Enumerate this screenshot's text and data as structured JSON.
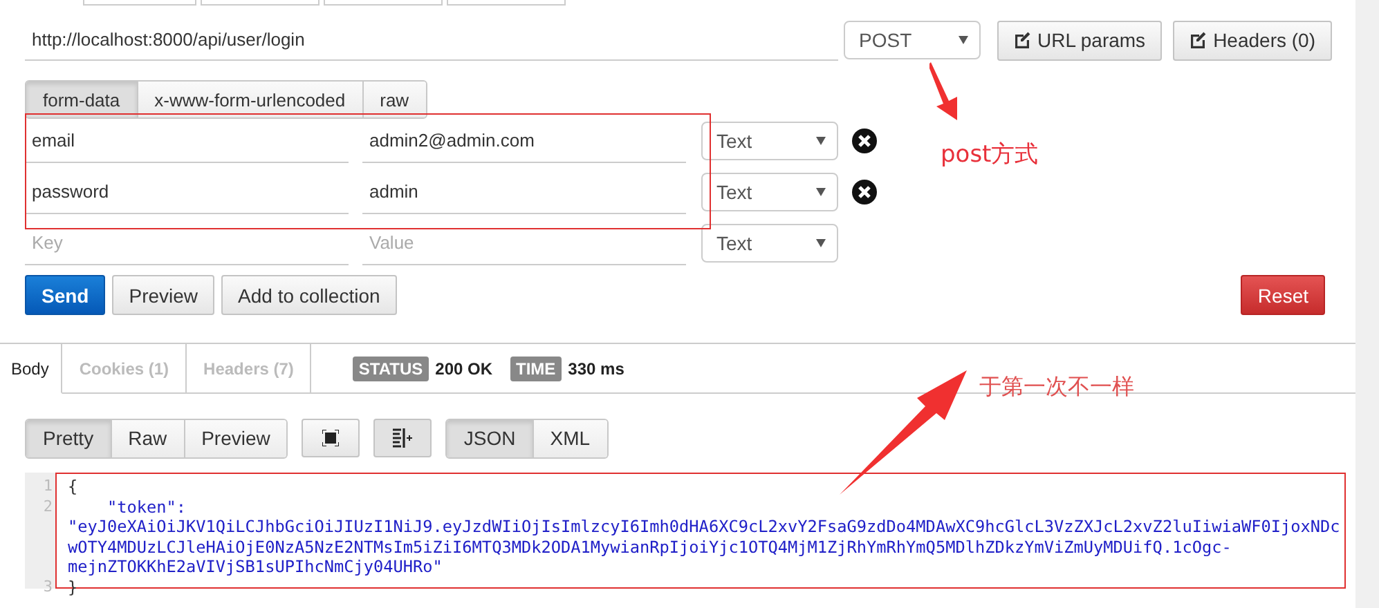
{
  "request": {
    "url": "http://localhost:8000/api/user/login",
    "method": "POST",
    "buttons": [
      {
        "label": "URL params"
      },
      {
        "label": "Headers (0)"
      }
    ]
  },
  "body_tabs": [
    {
      "label": "form-data",
      "selected": true
    },
    {
      "label": "x-www-form-urlencoded",
      "selected": false
    },
    {
      "label": "raw",
      "selected": false
    }
  ],
  "params": [
    {
      "key": "email",
      "value": "admin2@admin.com",
      "type": "Text",
      "removable": true
    },
    {
      "key": "password",
      "value": "admin",
      "type": "Text",
      "removable": true
    },
    {
      "key_placeholder": "Key",
      "value_placeholder": "Value",
      "type": "Text",
      "removable": false
    }
  ],
  "actions": [
    {
      "label": "Send",
      "kind": "primary"
    },
    {
      "label": "Preview",
      "kind": "default"
    },
    {
      "label": "Add to collection",
      "kind": "default"
    },
    {
      "label": "Reset",
      "kind": "danger"
    }
  ],
  "response_tabs": [
    {
      "label": "Body",
      "selected": true
    },
    {
      "label": "Cookies (1)",
      "selected": false
    },
    {
      "label": "Headers (7)",
      "selected": false
    }
  ],
  "status": {
    "label": "STATUS",
    "value": "200 OK"
  },
  "time": {
    "label": "TIME",
    "value": "330 ms"
  },
  "view_modes": [
    {
      "label": "Pretty",
      "selected": true
    },
    {
      "label": "Raw",
      "selected": false
    },
    {
      "label": "Preview",
      "selected": false
    }
  ],
  "formats": [
    {
      "label": "JSON",
      "selected": true
    },
    {
      "label": "XML",
      "selected": false
    }
  ],
  "code_lines": [
    {
      "number": "1",
      "text": "{"
    },
    {
      "number": "2",
      "text": "    \"token\": \"eyJ0eXAiOiJKV1QiLCJhbGciOiJIUzI1NiJ9.eyJzdWIiOjIsImlzcyI6Imh0dHA6XC9cL2xvY2FsaG9zdDo4MDAwXC9hcGlcL3VzZXJcL2xvZ2luIiwiaWF0IjoxNDcwOTY4MDUzLCJleHAiOjE0NzA5NzE2NTMsIm5iZiI6MTQ3MDk2ODA1MywianRpIjoiYjc1OTQ4MjM1ZjRhYmRhYmQ5MDlhZDkzYmViZmUyMDUifQ.1cOgc-mejnZTOKKhE2aVIVjSB1sUPIhcNmCjy04UHRo\""
    },
    {
      "number": "3",
      "text": "}"
    }
  ],
  "annotations": [
    {
      "text": "post方式"
    },
    {
      "text": "于第一次不一样"
    }
  ]
}
